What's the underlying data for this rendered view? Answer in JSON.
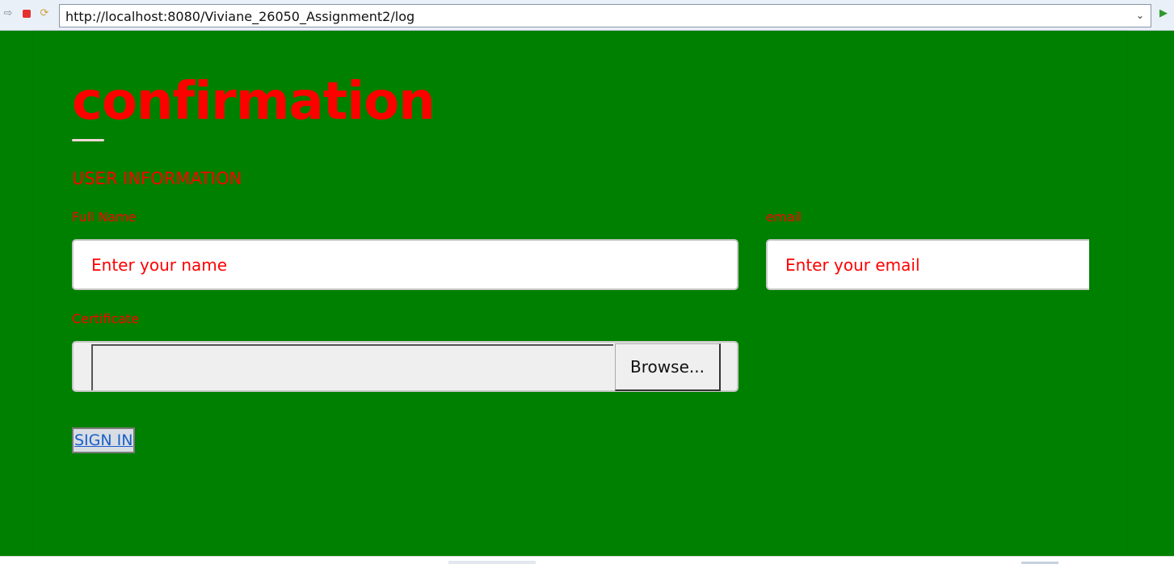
{
  "browser": {
    "url": "http://localhost:8080/Viviane_26050_Assignment2/log",
    "icons": {
      "back": "forward-arrow-icon",
      "stop": "stop-icon",
      "refresh": "refresh-icon",
      "dropdown": "chevron-down-icon",
      "go": "play-icon"
    }
  },
  "page": {
    "title": "confirmation",
    "section_title": "USER INFORMATION",
    "colors": {
      "background": "#008000",
      "text_accent": "#ff0000",
      "link": "#1a5fc9"
    }
  },
  "form": {
    "full_name": {
      "label": "Full Name",
      "placeholder": "Enter your name",
      "value": ""
    },
    "email": {
      "label": "email",
      "placeholder": "Enter your email",
      "value": ""
    },
    "certificate": {
      "label": "Certificate",
      "browse_label": "Browse..."
    },
    "submit_label": "SIGN IN"
  }
}
